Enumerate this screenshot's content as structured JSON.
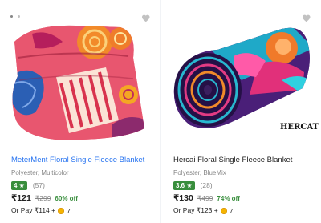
{
  "carousel": {
    "dot_count": 2,
    "active_index": 0
  },
  "products": [
    {
      "title": "MeterMent Floral Single Fleece Blanket",
      "subtitle": "Polyester, Multicolor",
      "rating": "4 ★",
      "rating_count": "(57)",
      "price": "₹121",
      "mrp": "₹299",
      "discount": "60% off",
      "pay_prefix": "Or Pay ₹114 +",
      "coins": "7",
      "wishlisted": false
    },
    {
      "title": "Hercai Floral Single Fleece Blanket",
      "subtitle": "Polyester, BlueMix",
      "rating": "3.6 ★",
      "rating_count": "(28)",
      "price": "₹130",
      "mrp": "₹499",
      "discount": "74% off",
      "pay_prefix": "Or Pay ₹123 +",
      "coins": "7",
      "wishlisted": false,
      "image_watermark": "HERCAT"
    }
  ],
  "colors": {
    "link_blue": "#2874f0",
    "rating_green": "#388e3c",
    "muted": "#878787",
    "coin": "#f5b400"
  }
}
